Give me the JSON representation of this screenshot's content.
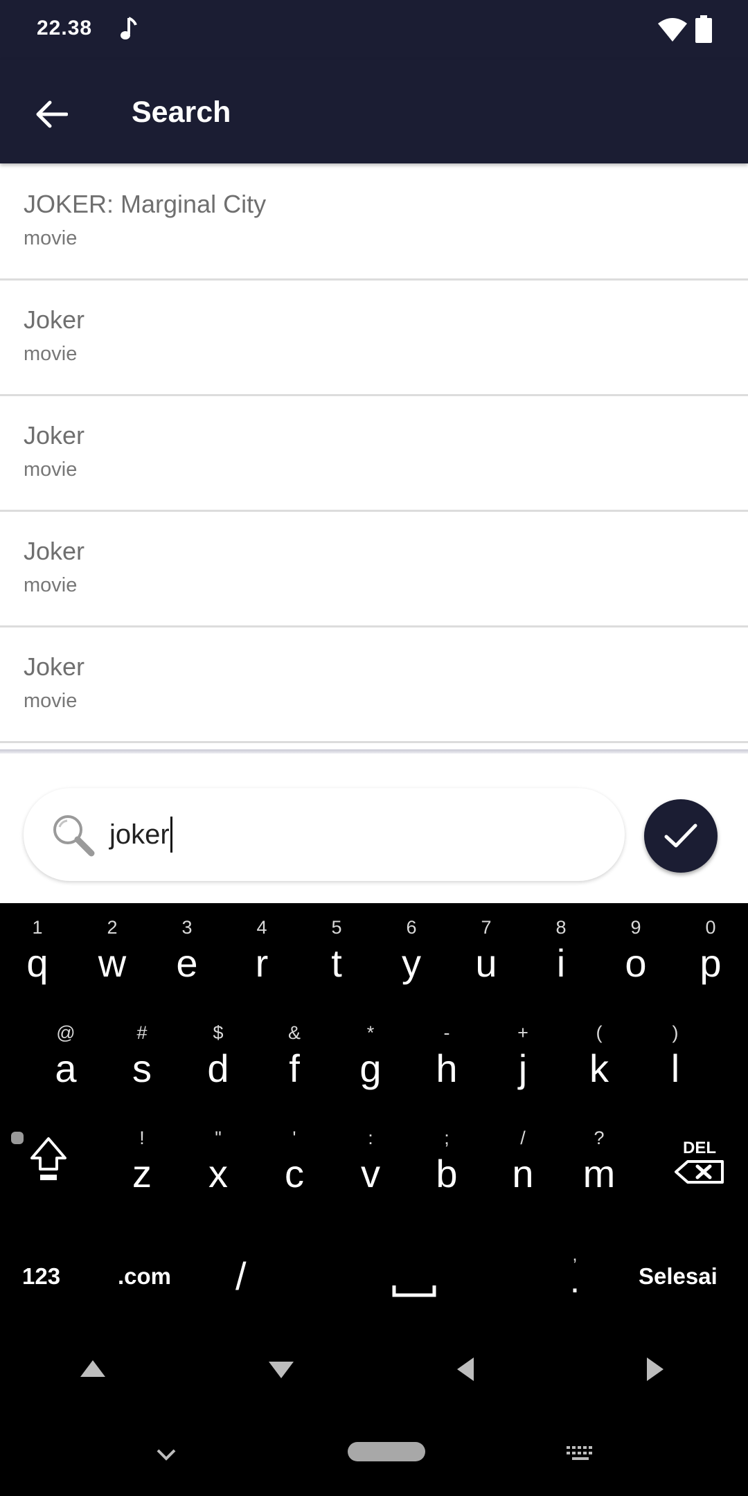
{
  "status_bar": {
    "time": "22.38"
  },
  "app_bar": {
    "title": "Search"
  },
  "results": [
    {
      "title": "JOKER: Marginal City",
      "type": "movie"
    },
    {
      "title": "Joker",
      "type": "movie"
    },
    {
      "title": "Joker",
      "type": "movie"
    },
    {
      "title": "Joker",
      "type": "movie"
    },
    {
      "title": "Joker",
      "type": "movie"
    }
  ],
  "search": {
    "value": "joker"
  },
  "keyboard": {
    "row1": [
      {
        "main": "q",
        "hint": "1"
      },
      {
        "main": "w",
        "hint": "2"
      },
      {
        "main": "e",
        "hint": "3"
      },
      {
        "main": "r",
        "hint": "4"
      },
      {
        "main": "t",
        "hint": "5"
      },
      {
        "main": "y",
        "hint": "6"
      },
      {
        "main": "u",
        "hint": "7"
      },
      {
        "main": "i",
        "hint": "8"
      },
      {
        "main": "o",
        "hint": "9"
      },
      {
        "main": "p",
        "hint": "0"
      }
    ],
    "row2": [
      {
        "main": "a",
        "hint": "@"
      },
      {
        "main": "s",
        "hint": "#"
      },
      {
        "main": "d",
        "hint": "$"
      },
      {
        "main": "f",
        "hint": "&"
      },
      {
        "main": "g",
        "hint": "*"
      },
      {
        "main": "h",
        "hint": "-"
      },
      {
        "main": "j",
        "hint": "+"
      },
      {
        "main": "k",
        "hint": "("
      },
      {
        "main": "l",
        "hint": ")"
      }
    ],
    "row3": [
      {
        "main": "z",
        "hint": "!"
      },
      {
        "main": "x",
        "hint": "\""
      },
      {
        "main": "c",
        "hint": "'"
      },
      {
        "main": "v",
        "hint": ":"
      },
      {
        "main": "b",
        "hint": ";"
      },
      {
        "main": "n",
        "hint": "/"
      },
      {
        "main": "m",
        "hint": "?"
      }
    ],
    "del_label": "DEL",
    "num_label": "123",
    "com_label": ".com",
    "slash_label": "/",
    "period_hint": ",",
    "period_label": ".",
    "done_label": "Selesai"
  }
}
